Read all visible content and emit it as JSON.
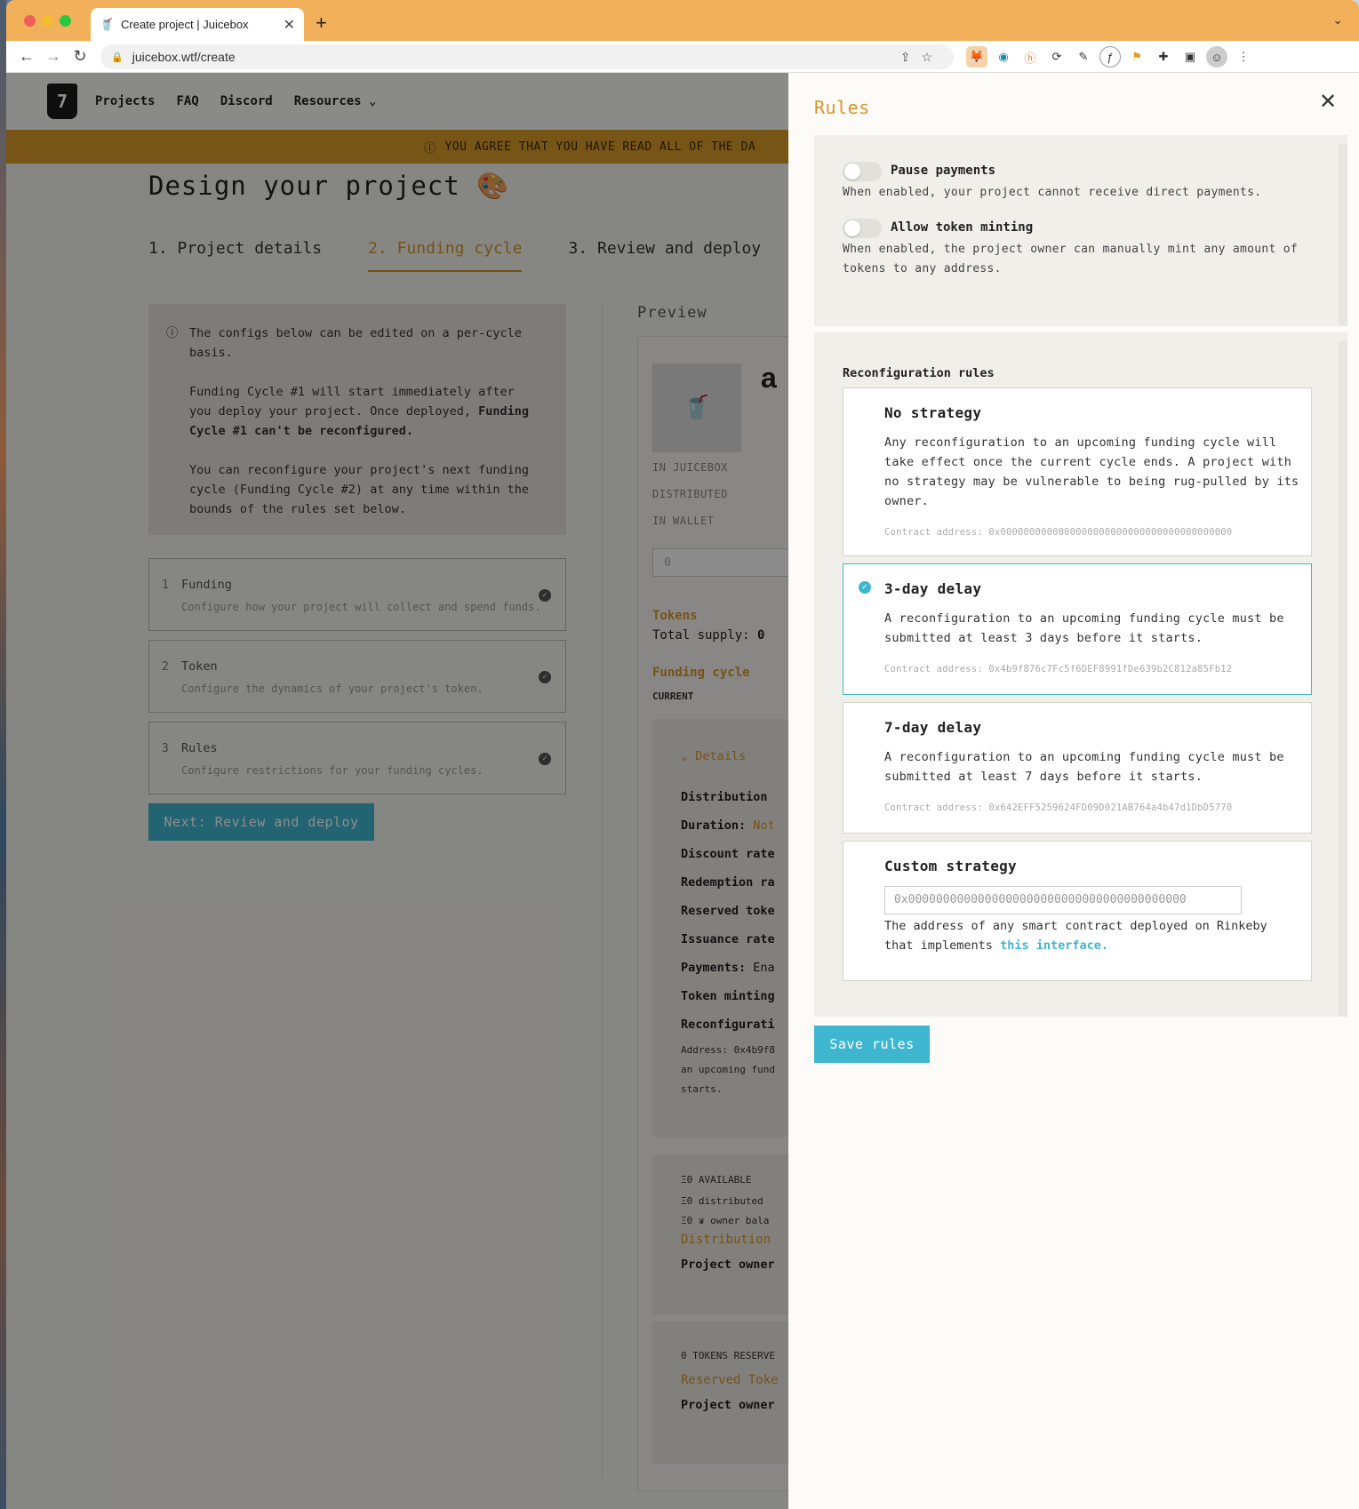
{
  "browser": {
    "tab_title": "Create project | Juicebox",
    "new_tab": "+",
    "url": "juicebox.wtf/create"
  },
  "site_nav": {
    "links": [
      "Projects",
      "FAQ",
      "Discord",
      "Resources"
    ]
  },
  "banner": {
    "text": "YOU AGREE THAT YOU HAVE READ ALL OF THE DA"
  },
  "main": {
    "title": "Design your project",
    "title_emoji": "🎨",
    "steps": [
      "1. Project details",
      "2. Funding cycle",
      "3. Review and deploy"
    ],
    "info_paragraphs": [
      "The configs below can be edited on a per-cycle basis.",
      "Funding Cycle #1 will start immediately after you deploy your project. Once deployed,",
      "Funding Cycle #1 can't be reconfigured.",
      "You can reconfigure your project's next funding cycle (Funding Cycle #2) at any time within the bounds of the rules set below."
    ],
    "cards": [
      {
        "num": "1",
        "label": "Funding",
        "desc": "Configure how your project will collect and spend funds."
      },
      {
        "num": "2",
        "label": "Token",
        "desc": "Configure the dynamics of your project's token."
      },
      {
        "num": "3",
        "label": "Rules",
        "desc": "Configure restrictions for your funding cycles."
      }
    ],
    "next_button": "Next: Review and deploy"
  },
  "preview": {
    "heading": "Preview",
    "project_name_partial": "a",
    "stats": [
      "IN JUICEBOX",
      "DISTRIBUTED",
      "IN WALLET"
    ],
    "pay_placeholder": "0",
    "tokens_label": "Tokens",
    "total_supply": "Total supply:",
    "total_supply_value": "0",
    "funding_cycle_label": "Funding cycle",
    "current_label": "CURRENT",
    "details_toggle": "Details",
    "details": [
      {
        "label": "Distribution",
        "value": ""
      },
      {
        "label": "Duration:",
        "value": "Not"
      },
      {
        "label": "Discount rate",
        "value": ""
      },
      {
        "label": "Redemption ra",
        "value": ""
      },
      {
        "label": "Reserved toke",
        "value": ""
      },
      {
        "label": "Issuance rate",
        "value": ""
      },
      {
        "label": "Payments:",
        "value": "Ena"
      },
      {
        "label": "Token minting",
        "value": ""
      },
      {
        "label": "Reconfigurati",
        "value": ""
      }
    ],
    "recon_address_lines": [
      "Address: 0x4b9f8",
      "an upcoming fund",
      "starts."
    ],
    "available": "Ξ0 AVAILABLE",
    "distributed": "Ξ0 distributed",
    "owner_balance": "Ξ0 ♛ owner bala",
    "distribution_label": "Distribution",
    "project_owner": "Project owner",
    "tokens_reserved": "0 TOKENS RESERVE",
    "reserved_tokens_label": "Reserved Toke",
    "project_owner_2": "Project owner"
  },
  "drawer": {
    "title": "Rules",
    "pause_payments": {
      "label": "Pause payments",
      "desc": "When enabled, your project cannot receive direct payments.",
      "enabled": false
    },
    "allow_minting": {
      "label": "Allow token minting",
      "desc": "When enabled, the project owner can manually mint any amount of tokens to any address.",
      "enabled": false
    },
    "reconfiguration_label": "Reconfiguration rules",
    "strategies": [
      {
        "title": "No strategy",
        "desc": "Any reconfiguration to an upcoming funding cycle will take effect once the current cycle ends. A project with no strategy may be vulnerable to being rug-pulled by its owner.",
        "address": "Contract address: 0x0000000000000000000000000000000000000000"
      },
      {
        "title": "3-day delay",
        "desc": "A reconfiguration to an upcoming funding cycle must be submitted at least 3 days before it starts.",
        "address": "Contract address: 0x4b9f876c7Fc5f6DEF8991fDe639b2C812a85Fb12",
        "selected": true
      },
      {
        "title": "7-day delay",
        "desc": "A reconfiguration to an upcoming funding cycle must be submitted at least 7 days before it starts.",
        "address": "Contract address: 0x642EFF5259624FD09D021AB764a4b47d1DbD5770"
      }
    ],
    "custom": {
      "title": "Custom strategy",
      "placeholder": "0x0000000000000000000000000000000000000000",
      "desc": "The address of any smart contract deployed on Rinkeby that implements",
      "link": "this interface."
    },
    "save_button": "Save rules"
  },
  "colors": {
    "accent_orange": "#d9952b",
    "accent_teal": "#3fb6cf",
    "chrome_orange": "#f2b05a"
  }
}
